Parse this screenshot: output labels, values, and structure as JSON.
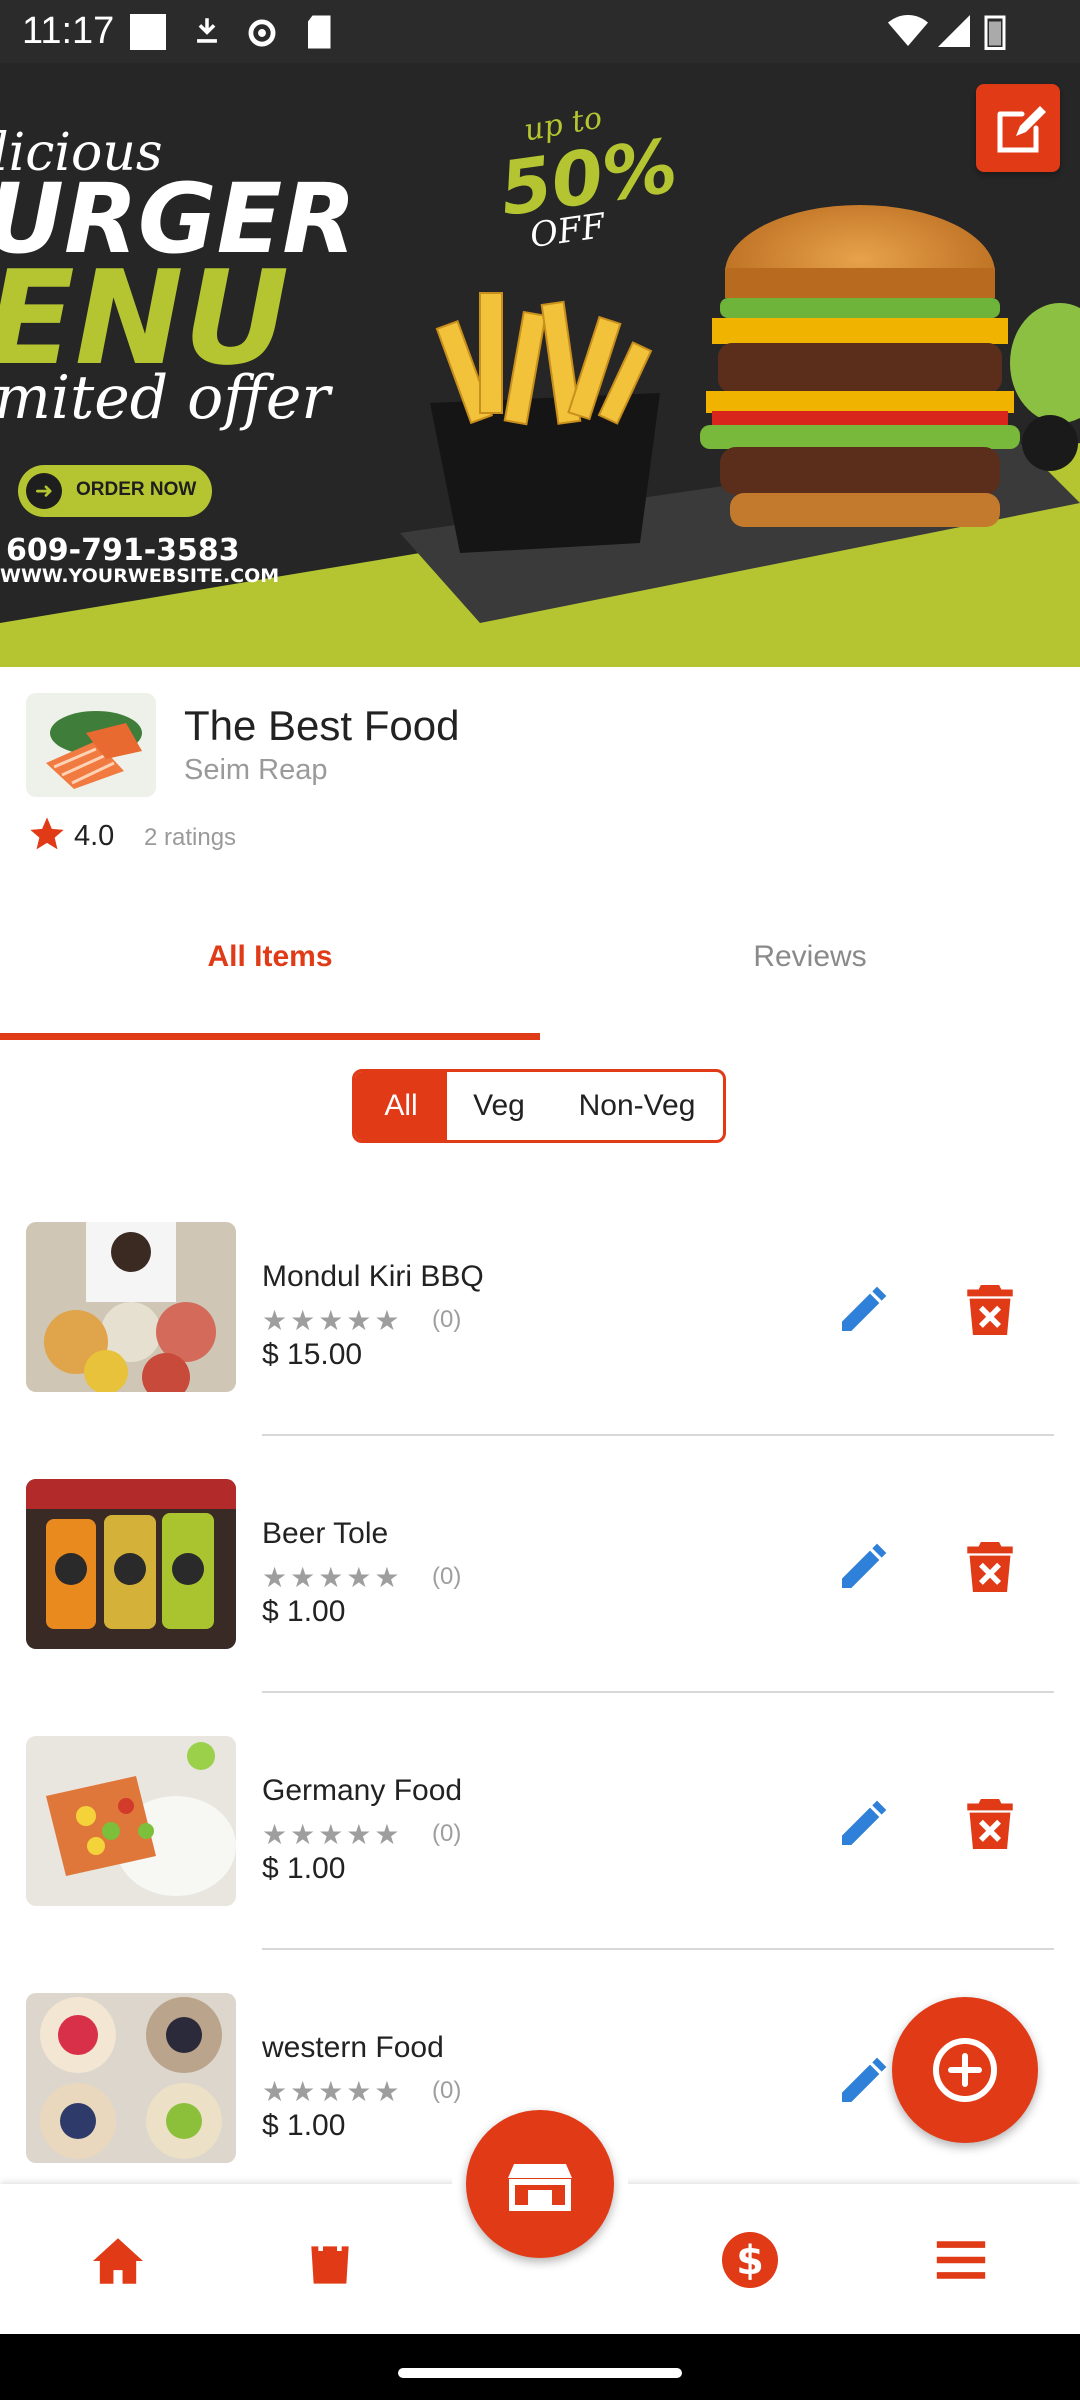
{
  "status_bar": {
    "time": "11:17"
  },
  "banner": {
    "line1": "licious",
    "line2": "URGER",
    "line3": "ENU",
    "line4": "mited offer",
    "promo_up": "up to",
    "promo_pct": "50%",
    "promo_off": "OFF",
    "order_button": "ORDER NOW",
    "phone": "609-791-3583",
    "website": "WWW.YOURWEBSITE.COM"
  },
  "restaurant": {
    "name": "The Best Food",
    "location": "Seim Reap",
    "rating": "4.0",
    "ratings_count": "2 ratings"
  },
  "tabs": {
    "all_items": "All Items",
    "reviews": "Reviews",
    "selected": "All Items"
  },
  "filter": {
    "options": [
      "All",
      "Veg",
      "Non-Veg"
    ],
    "selected": "All"
  },
  "items": [
    {
      "name": "Mondul Kiri BBQ",
      "stars": "★★★★★",
      "review_count": "(0)",
      "price": "$ 15.00"
    },
    {
      "name": "Beer Tole",
      "stars": "★★★★★",
      "review_count": "(0)",
      "price": "$ 1.00"
    },
    {
      "name": "Germany Food",
      "stars": "★★★★★",
      "review_count": "(0)",
      "price": "$ 1.00"
    },
    {
      "name": "western Food",
      "stars": "★★★★★",
      "review_count": "(0)",
      "price": "$ 1.00"
    }
  ],
  "colors": {
    "accent": "#e03a17",
    "edit": "#2f80d8",
    "lime": "#b4c531"
  },
  "icons": [
    "edit-banner-icon",
    "pencil-icon",
    "trash-icon",
    "add-circle-icon",
    "store-icon",
    "home-icon",
    "shopping-bag-icon",
    "dollar-icon",
    "menu-icon",
    "star-icon"
  ]
}
